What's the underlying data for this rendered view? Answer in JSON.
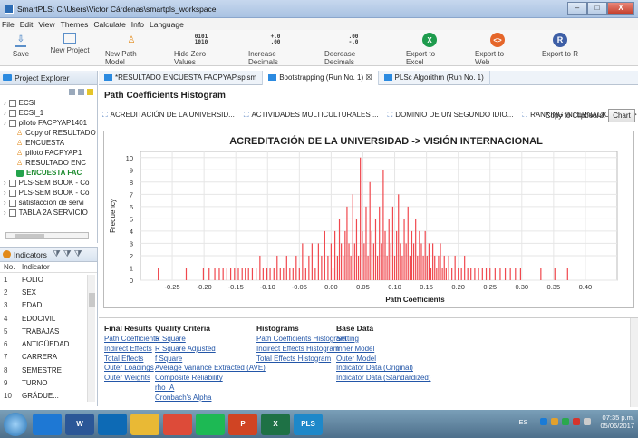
{
  "window": {
    "title": "SmartPLS: C:\\Users\\Victor Cárdenas\\smartpls_workspace"
  },
  "menu": [
    "File",
    "Edit",
    "View",
    "Themes",
    "Calculate",
    "Info",
    "Language"
  ],
  "toolbar": [
    {
      "label": "Save",
      "icon": "save-icon"
    },
    {
      "label": "New Project",
      "icon": "new-project-icon"
    },
    {
      "label": "New Path Model",
      "icon": "new-path-model-icon"
    },
    {
      "label": "Hide Zero Values",
      "icon": "hide-zero-values-icon"
    },
    {
      "label": "Increase Decimals",
      "icon": "increase-decimals-icon"
    },
    {
      "label": "Decrease Decimals",
      "icon": "decrease-decimals-icon"
    },
    {
      "label": "Export to Excel",
      "icon": "excel-icon"
    },
    {
      "label": "Export to Web",
      "icon": "web-icon"
    },
    {
      "label": "Export to R",
      "icon": "r-icon"
    }
  ],
  "project_explorer": {
    "title": "Project Explorer",
    "items": [
      {
        "label": "ECSI",
        "level": 0,
        "type": "project"
      },
      {
        "label": "ECSI_1",
        "level": 0,
        "type": "project"
      },
      {
        "label": "piloto FACPYAP1401",
        "level": 0,
        "type": "project"
      },
      {
        "label": "Copy of RESULTADO",
        "level": 1,
        "type": "model"
      },
      {
        "label": "ENCUESTA",
        "level": 1,
        "type": "model"
      },
      {
        "label": "piloto FACPYAP1",
        "level": 1,
        "type": "model"
      },
      {
        "label": "RESULTADO ENC",
        "level": 1,
        "type": "model"
      },
      {
        "label": "ENCUESTA FAC",
        "level": 1,
        "type": "data",
        "active": true
      },
      {
        "label": "PLS-SEM BOOK - Co",
        "level": 0,
        "type": "project"
      },
      {
        "label": "PLS-SEM BOOK - Co",
        "level": 0,
        "type": "project"
      },
      {
        "label": "satisfaccion de servi",
        "level": 0,
        "type": "project"
      },
      {
        "label": "TABLA 2A SERVICIO",
        "level": 0,
        "type": "project"
      }
    ]
  },
  "indicators": {
    "title": "Indicators",
    "col_no": "No.",
    "col_indicator": "Indicator",
    "rows": [
      {
        "n": "1",
        "name": "FOLIO"
      },
      {
        "n": "2",
        "name": "SEX"
      },
      {
        "n": "3",
        "name": "EDAD"
      },
      {
        "n": "4",
        "name": "EDOCIVIL"
      },
      {
        "n": "5",
        "name": "TRABAJAS"
      },
      {
        "n": "6",
        "name": "ANTIGÜEDAD"
      },
      {
        "n": "7",
        "name": "CARRERA"
      },
      {
        "n": "8",
        "name": "SEMESTRE"
      },
      {
        "n": "9",
        "name": "TURNO"
      },
      {
        "n": "10",
        "name": "GRÁDUE..."
      }
    ]
  },
  "doc_tabs": [
    {
      "label": "*RESULTADO ENCUESTA FACPYAP.splsm",
      "active": false
    },
    {
      "label": "Bootstrapping (Run No. 1) ☒",
      "active": true
    },
    {
      "label": "PLSc Algorithm (Run No. 1)",
      "active": false
    }
  ],
  "section_title": "Path Coefficients Histogram",
  "chart_tabs": [
    "ACREDITACIÓN DE LA UNIVERSID...",
    "ACTIVIDADES MULTICULTURALES ...",
    "DOMINIO DE UN SEGUNDO IDIO...",
    "RANKING INTERNACIONAL_ -> VIS..."
  ],
  "copy_label": "Copy to Clipboard:",
  "chart_button": "Chart",
  "chart_data": {
    "type": "bar",
    "title": "ACREDITACIÓN DE LA UNIVERSIDAD -> VISIÓN INTERNACIONAL",
    "xlabel": "Path Coefficients",
    "ylabel": "Frequency",
    "xlim": [
      -0.3,
      0.45
    ],
    "ylim": [
      0,
      10.5
    ],
    "xticks": [
      -0.25,
      -0.2,
      -0.15,
      -0.1,
      -0.05,
      0.0,
      0.05,
      0.1,
      0.15,
      0.2,
      0.25,
      0.3,
      0.35,
      0.4
    ],
    "xtick_labels": [
      "-0.25",
      "-0.20",
      "-0.15",
      "-0.10",
      "-0.05",
      "0.00",
      "0.05",
      "0.10",
      "0.15",
      "0.20",
      "0.25",
      "0.30",
      "0.35",
      "0.40"
    ],
    "yticks": [
      0,
      1,
      2,
      3,
      4,
      5,
      6,
      7,
      8,
      9,
      10
    ],
    "bar_color": "#f0484e",
    "bars": [
      [
        -0.272,
        1
      ],
      [
        -0.228,
        1
      ],
      [
        -0.201,
        1
      ],
      [
        -0.192,
        1
      ],
      [
        -0.183,
        1
      ],
      [
        -0.176,
        1
      ],
      [
        -0.17,
        1
      ],
      [
        -0.164,
        1
      ],
      [
        -0.158,
        1
      ],
      [
        -0.152,
        1
      ],
      [
        -0.146,
        1
      ],
      [
        -0.14,
        1
      ],
      [
        -0.135,
        1
      ],
      [
        -0.13,
        1
      ],
      [
        -0.124,
        1
      ],
      [
        -0.118,
        1
      ],
      [
        -0.112,
        2
      ],
      [
        -0.107,
        1
      ],
      [
        -0.101,
        1
      ],
      [
        -0.096,
        1
      ],
      [
        -0.09,
        1
      ],
      [
        -0.085,
        2
      ],
      [
        -0.08,
        1
      ],
      [
        -0.075,
        1
      ],
      [
        -0.07,
        2
      ],
      [
        -0.065,
        1
      ],
      [
        -0.06,
        1
      ],
      [
        -0.055,
        2
      ],
      [
        -0.05,
        1
      ],
      [
        -0.045,
        3
      ],
      [
        -0.04,
        1
      ],
      [
        -0.035,
        2
      ],
      [
        -0.03,
        3
      ],
      [
        -0.025,
        1
      ],
      [
        -0.02,
        3
      ],
      [
        -0.015,
        2
      ],
      [
        -0.01,
        4
      ],
      [
        -0.005,
        2
      ],
      [
        0.0,
        3
      ],
      [
        0.003,
        1
      ],
      [
        0.006,
        4
      ],
      [
        0.01,
        2
      ],
      [
        0.013,
        5
      ],
      [
        0.016,
        3
      ],
      [
        0.019,
        2
      ],
      [
        0.022,
        4
      ],
      [
        0.025,
        6
      ],
      [
        0.028,
        3
      ],
      [
        0.031,
        2
      ],
      [
        0.034,
        7
      ],
      [
        0.037,
        3
      ],
      [
        0.04,
        5
      ],
      [
        0.043,
        2
      ],
      [
        0.046,
        10
      ],
      [
        0.049,
        4
      ],
      [
        0.052,
        3
      ],
      [
        0.055,
        6
      ],
      [
        0.058,
        2
      ],
      [
        0.061,
        8
      ],
      [
        0.064,
        4
      ],
      [
        0.067,
        3
      ],
      [
        0.07,
        5
      ],
      [
        0.073,
        2
      ],
      [
        0.076,
        6
      ],
      [
        0.079,
        3
      ],
      [
        0.082,
        9
      ],
      [
        0.085,
        4
      ],
      [
        0.088,
        2
      ],
      [
        0.091,
        5
      ],
      [
        0.094,
        3
      ],
      [
        0.097,
        6
      ],
      [
        0.1,
        2
      ],
      [
        0.103,
        4
      ],
      [
        0.106,
        7
      ],
      [
        0.109,
        3
      ],
      [
        0.112,
        2
      ],
      [
        0.115,
        5
      ],
      [
        0.118,
        3
      ],
      [
        0.121,
        6
      ],
      [
        0.124,
        2
      ],
      [
        0.127,
        4
      ],
      [
        0.13,
        3
      ],
      [
        0.133,
        5
      ],
      [
        0.136,
        2
      ],
      [
        0.139,
        4
      ],
      [
        0.142,
        3
      ],
      [
        0.145,
        2
      ],
      [
        0.148,
        4
      ],
      [
        0.151,
        2
      ],
      [
        0.154,
        3
      ],
      [
        0.157,
        1
      ],
      [
        0.16,
        3
      ],
      [
        0.163,
        2
      ],
      [
        0.166,
        1
      ],
      [
        0.169,
        2
      ],
      [
        0.172,
        3
      ],
      [
        0.175,
        1
      ],
      [
        0.178,
        2
      ],
      [
        0.181,
        1
      ],
      [
        0.185,
        2
      ],
      [
        0.19,
        1
      ],
      [
        0.195,
        2
      ],
      [
        0.2,
        1
      ],
      [
        0.205,
        1
      ],
      [
        0.21,
        2
      ],
      [
        0.215,
        1
      ],
      [
        0.22,
        1
      ],
      [
        0.226,
        1
      ],
      [
        0.232,
        1
      ],
      [
        0.238,
        1
      ],
      [
        0.244,
        1
      ],
      [
        0.25,
        1
      ],
      [
        0.258,
        1
      ],
      [
        0.266,
        1
      ],
      [
        0.274,
        1
      ],
      [
        0.282,
        1
      ],
      [
        0.29,
        1
      ],
      [
        0.298,
        1
      ],
      [
        0.33,
        1
      ],
      [
        0.352,
        1
      ],
      [
        0.372,
        1
      ]
    ]
  },
  "bottom_links": {
    "final_results": {
      "title": "Final Results",
      "items": [
        "Path Coefficients",
        "Indirect Effects",
        "Total Effects",
        "Outer Loadings",
        "Outer Weights"
      ]
    },
    "quality_criteria": {
      "title": "Quality Criteria",
      "items": [
        "R Square",
        "R Square Adjusted",
        "f Square",
        "Average Variance Extracted (AVE)",
        "Composite Reliability",
        "rho_A",
        "Cronbach's Alpha"
      ]
    },
    "histograms": {
      "title": "Histograms",
      "items": [
        "Path Coefficients Histogram",
        "Indirect Effects Histogram",
        "Total Effects Histogram"
      ]
    },
    "base_data": {
      "title": "Base Data",
      "items": [
        "Setting",
        "Inner Model",
        "Outer Model",
        "Indicator Data (Original)",
        "Indicator Data (Standardized)"
      ]
    }
  },
  "taskbar": {
    "apps": [
      "ie",
      "word",
      "outlook",
      "explorer",
      "chrome",
      "spotify",
      "powerpoint",
      "excel",
      "smartpls"
    ],
    "app_labels": {
      "word": "W",
      "powerpoint": "P",
      "excel": "X",
      "smartpls": "PLS"
    },
    "lang": "ES",
    "time": "07:35 p.m.",
    "date": "05/06/2017"
  }
}
